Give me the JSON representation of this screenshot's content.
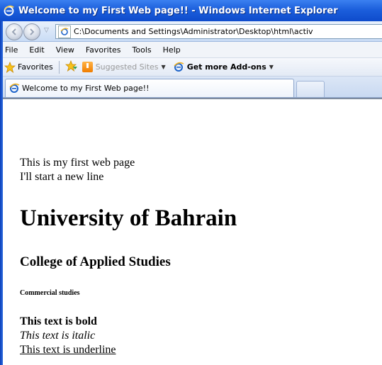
{
  "window": {
    "title": "Welcome to my First Web page!! - Windows Internet Explorer"
  },
  "address_bar": {
    "url": "C:\\Documents and Settings\\Administrator\\Desktop\\html\\activ"
  },
  "menu": {
    "items": [
      "File",
      "Edit",
      "View",
      "Favorites",
      "Tools",
      "Help"
    ]
  },
  "favorites_bar": {
    "favorites_label": "Favorites",
    "suggested_sites_label": "Suggested Sites",
    "addons_label": "Get more Add-ons"
  },
  "tab": {
    "label": "Welcome to my First Web page!!"
  },
  "content": {
    "line1": "This is my first web page",
    "line2": "I'll start a new line",
    "heading1": "University of Bahrain",
    "heading3": "College of Applied Studies",
    "heading6": "Commercial studies",
    "bold_text": "This text is bold",
    "italic_text": "This text is italic",
    "underline_text": "This text is underline"
  },
  "colors": {
    "titlebar_blue": "#1c5fdc",
    "content_bg": "#ffffff"
  }
}
